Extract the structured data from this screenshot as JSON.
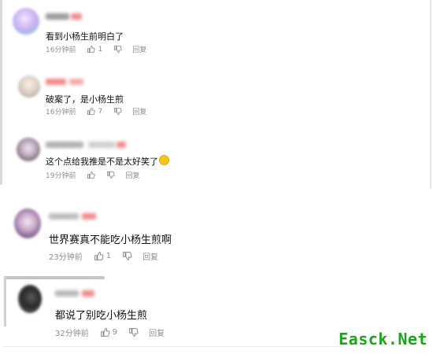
{
  "comments": [
    {
      "text": "看到小杨生前明白了",
      "time": "16分钟前",
      "likes": "1",
      "reply_label": "回复"
    },
    {
      "text": "破案了，是小杨生煎",
      "time": "16分钟前",
      "likes": "7",
      "reply_label": "回复"
    },
    {
      "text": "这个点给我推是不是太好笑了",
      "time": "19分钟前",
      "likes": "",
      "reply_label": "回复"
    },
    {
      "text": "世界赛真不能吃小杨生煎啊",
      "time": "23分钟前",
      "likes": "1",
      "reply_label": "回复"
    },
    {
      "text": "都说了别吃小杨生煎",
      "time": "32分钟前",
      "likes": "9",
      "reply_label": "回复"
    }
  ],
  "watermark": "Easck.Net",
  "colors": {
    "meta_text": "#8e8e8e",
    "name_blur_red": "#f08a8a",
    "watermark_green": "#1aa61a",
    "emoji_yellow": "#f5c518"
  },
  "icons": {
    "like": "thumbs-up-icon",
    "dislike": "thumbs-down-icon",
    "emoji": "laughing-emoji-icon"
  }
}
